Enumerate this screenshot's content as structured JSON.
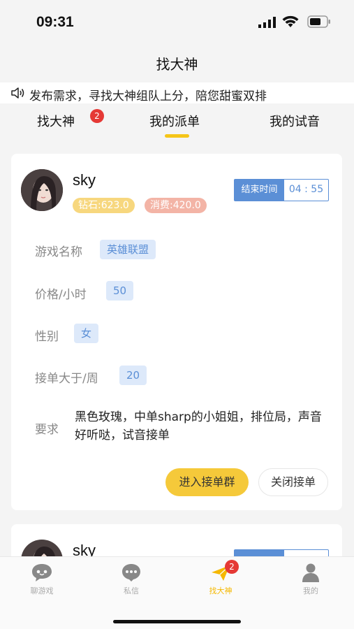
{
  "status_bar": {
    "time": "09:31"
  },
  "nav": {
    "title": "找大神"
  },
  "notice": {
    "text": "发布需求，寻找大神组队上分，陪您甜蜜双排"
  },
  "tabs": [
    {
      "label": "找大神",
      "badge": "2"
    },
    {
      "label": "我的派单",
      "active": true
    },
    {
      "label": "我的试音"
    }
  ],
  "card": {
    "username": "sky",
    "diamond": "钻石:623.0",
    "spend": "消费:420.0",
    "end_time_label": "结束时间",
    "end_time_value": "04 : 55",
    "game_label": "游戏名称",
    "game_value": "英雄联盟",
    "price_label": "价格/小时",
    "price_value": "50",
    "gender_label": "性别",
    "gender_value": "女",
    "orders_label": "接单大于/周",
    "orders_value": "20",
    "req_label": "要求",
    "req_value": "黑色玫瑰，中单sharp的小姐姐，排位局，声音好听哒，试音接单",
    "join_button": "进入接单群",
    "close_button": "关闭接单"
  },
  "card2": {
    "username": "sky"
  },
  "tabbar": [
    {
      "label": "聊游戏",
      "icon": "chat-game-icon"
    },
    {
      "label": "私信",
      "icon": "message-icon"
    },
    {
      "label": "找大神",
      "icon": "paper-plane-icon",
      "badge": "2",
      "active": true
    },
    {
      "label": "我的",
      "icon": "person-icon"
    }
  ],
  "colors": {
    "accent": "#f5c518",
    "blue": "#5b8fd6",
    "badge_red": "#e53935"
  }
}
